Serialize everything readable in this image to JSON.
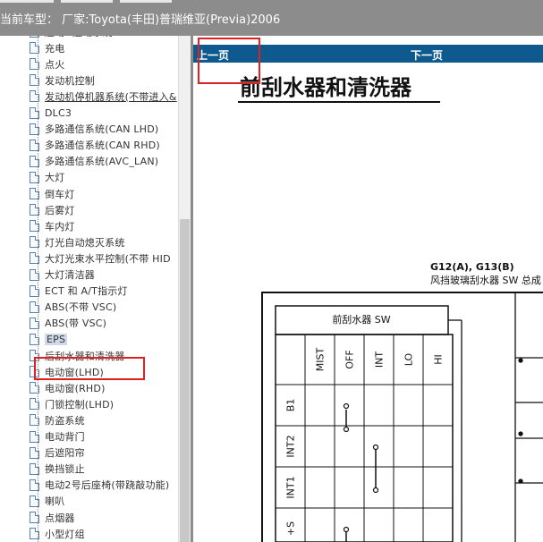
{
  "header": {
    "car_label": "当前车型：  厂家:Toyota(丰田)普瑞维亚(Previa)2006"
  },
  "sidebar": {
    "items": [
      {
        "label": "起动&起动系统"
      },
      {
        "label": "充电"
      },
      {
        "label": "点火"
      },
      {
        "label": "发动机控制"
      },
      {
        "label": "发动机停机器系统(不带进入&"
      },
      {
        "label": "DLC3"
      },
      {
        "label": "多路通信系统(CAN LHD)"
      },
      {
        "label": "多路通信系统(CAN RHD)"
      },
      {
        "label": "多路通信系统(AVC_LAN)"
      },
      {
        "label": "大灯"
      },
      {
        "label": "倒车灯"
      },
      {
        "label": "后雾灯"
      },
      {
        "label": "车内灯"
      },
      {
        "label": "灯光自动熄灭系统"
      },
      {
        "label": "大灯光束水平控制(不带 HID"
      },
      {
        "label": "大灯清洁器"
      },
      {
        "label": "ECT 和 A/T指示灯"
      },
      {
        "label": "ABS(不带 VSC)"
      },
      {
        "label": "ABS(带 VSC)"
      },
      {
        "label": "EPS"
      },
      {
        "label": "后刮水器和清洗器"
      },
      {
        "label": "电动窗(LHD)"
      },
      {
        "label": "电动窗(RHD)"
      },
      {
        "label": "门锁控制(LHD)"
      },
      {
        "label": "防盗系统"
      },
      {
        "label": "电动背门"
      },
      {
        "label": "后遮阳帘"
      },
      {
        "label": "换挡锁止"
      },
      {
        "label": "电动2号后座椅(带跷敲功能)"
      },
      {
        "label": "喇叭"
      },
      {
        "label": "点烟器"
      },
      {
        "label": "小型灯组"
      }
    ]
  },
  "content": {
    "nav_prev": "上一页",
    "nav_next": "下一页",
    "title": "前刮水器和清洗器",
    "connector_label": "G12(A), G13(B)",
    "connector_sub": "风挡玻璃刮水器 SW 总成",
    "table": {
      "header": "前刮水器 SW",
      "columns": [
        "MIST",
        "OFF",
        "INT",
        "LO",
        "HI"
      ],
      "rows": [
        "B1",
        "INT2",
        "INT1",
        "+S"
      ]
    }
  },
  "colors": {
    "topbar": "#8c8c8c",
    "navbar": "#0e5a8e",
    "highlight_box": "#e02020",
    "selected_item": "#cfd9ea"
  }
}
